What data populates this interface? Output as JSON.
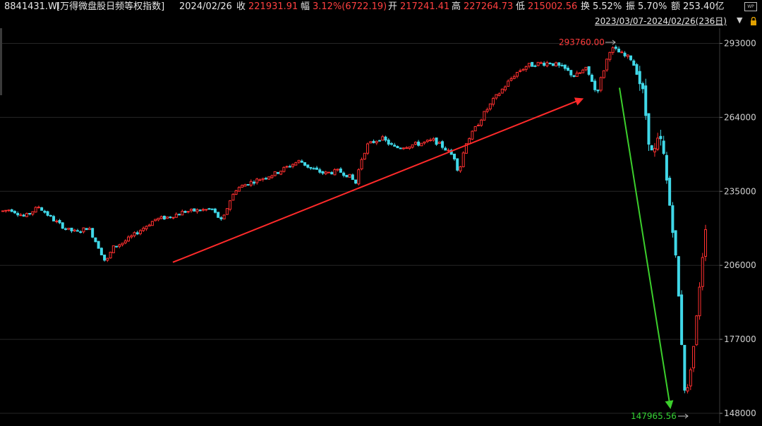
{
  "header": {
    "code": "8841431.WI",
    "name": "[万得微盘股日频等权指数]",
    "date": "2024/02/26",
    "close_label": "收",
    "close_value": "221931.91",
    "change_label": "幅",
    "change_value": "3.12%(6722.19)",
    "open_label": "开",
    "open_value": "217241.41",
    "high_label": "高",
    "high_value": "227264.73",
    "low_label": "低",
    "low_value": "215002.56",
    "turnover_label": "换",
    "turnover_value": "5.52%",
    "amplitude_label": "振",
    "amplitude_value": "5.70%",
    "amount_label": "额",
    "amount_value": "253.40亿",
    "date_range": "2023/03/07-2024/02/26(236日)"
  },
  "colors": {
    "up": "#ff3030",
    "down": "#40d8e8",
    "grid": "#262626",
    "background": "#000000"
  },
  "icons": {
    "dropdown": "triangle-down-icon",
    "lock": "lock-icon",
    "watermark": "wp-icon"
  },
  "chart_data": {
    "type": "candlestick",
    "title": "",
    "ylim": [
      140000,
      296000
    ],
    "yticks": [
      {
        "value": 293000,
        "label": "293000"
      },
      {
        "value": 264000,
        "label": "264000"
      },
      {
        "value": 235000,
        "label": "235000"
      },
      {
        "value": 206000,
        "label": "206000"
      },
      {
        "value": 177000,
        "label": "177000"
      },
      {
        "value": 148000,
        "label": "148000"
      }
    ],
    "period_high": {
      "value": 293760.0,
      "label": "293760.00"
    },
    "period_low": {
      "value": 147965.56,
      "label": "147965.56"
    },
    "price_path": [
      [
        0,
        227000
      ],
      [
        15,
        228000
      ],
      [
        35,
        225000
      ],
      [
        55,
        229000
      ],
      [
        75,
        224000
      ],
      [
        95,
        220000
      ],
      [
        110,
        219000
      ],
      [
        125,
        221000
      ],
      [
        140,
        213000
      ],
      [
        150,
        207000
      ],
      [
        160,
        213000
      ],
      [
        175,
        215000
      ],
      [
        190,
        218000
      ],
      [
        205,
        221000
      ],
      [
        220,
        224000
      ],
      [
        240,
        225000
      ],
      [
        260,
        227000
      ],
      [
        280,
        227500
      ],
      [
        300,
        228000
      ],
      [
        315,
        223000
      ],
      [
        325,
        231000
      ],
      [
        335,
        236000
      ],
      [
        350,
        238000
      ],
      [
        370,
        240000
      ],
      [
        390,
        242000
      ],
      [
        410,
        245000
      ],
      [
        425,
        247000
      ],
      [
        440,
        244000
      ],
      [
        460,
        242000
      ],
      [
        480,
        243000
      ],
      [
        495,
        241000
      ],
      [
        505,
        238000
      ],
      [
        510,
        246000
      ],
      [
        520,
        253000
      ],
      [
        540,
        256000
      ],
      [
        560,
        252000
      ],
      [
        580,
        253000
      ],
      [
        600,
        254000
      ],
      [
        615,
        255000
      ],
      [
        630,
        252000
      ],
      [
        645,
        248000
      ],
      [
        650,
        242000
      ],
      [
        660,
        254000
      ],
      [
        670,
        258000
      ],
      [
        685,
        265000
      ],
      [
        700,
        271000
      ],
      [
        715,
        276000
      ],
      [
        730,
        281000
      ],
      [
        745,
        284000
      ],
      [
        760,
        285000
      ],
      [
        780,
        285500
      ],
      [
        800,
        283000
      ],
      [
        815,
        280000
      ],
      [
        830,
        283000
      ],
      [
        840,
        278000
      ],
      [
        845,
        273000
      ],
      [
        855,
        282000
      ],
      [
        865,
        291000
      ],
      [
        875,
        290000
      ],
      [
        885,
        288000
      ],
      [
        895,
        287000
      ],
      [
        905,
        280000
      ],
      [
        912,
        272000
      ],
      [
        920,
        255000
      ],
      [
        925,
        248000
      ],
      [
        935,
        256000
      ],
      [
        940,
        250000
      ],
      [
        948,
        232000
      ],
      [
        955,
        218000
      ],
      [
        962,
        193000
      ],
      [
        968,
        168000
      ],
      [
        972,
        151000
      ],
      [
        978,
        165000
      ],
      [
        985,
        178000
      ],
      [
        992,
        200000
      ],
      [
        1000,
        221900
      ]
    ],
    "trend_lines": [
      {
        "color": "red",
        "from": {
          "x": 245,
          "y": 207200
        },
        "to": {
          "x": 825,
          "y": 271200
        }
      },
      {
        "color": "green",
        "from": {
          "x": 878,
          "y": 275600
        },
        "to": {
          "x": 950,
          "y": 150300
        }
      }
    ]
  }
}
